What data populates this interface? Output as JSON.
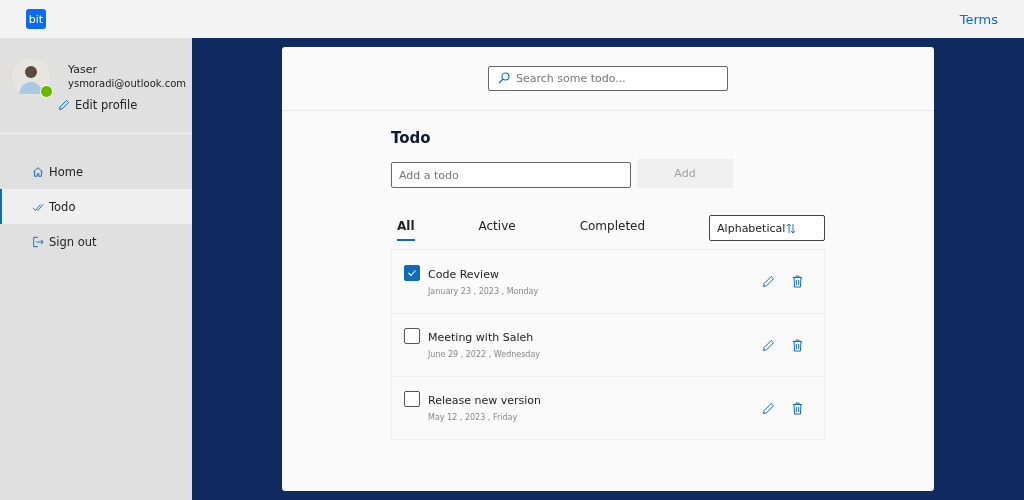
{
  "header": {
    "logo": "bit",
    "link": "Terms"
  },
  "profile": {
    "name": "Yaser",
    "email": "ysmoradi@outlook.com",
    "online": true,
    "edit_label": "Edit profile"
  },
  "nav": [
    {
      "label": "Home",
      "kind": "home",
      "selected": false
    },
    {
      "label": "Todo",
      "kind": "todo",
      "selected": true
    },
    {
      "label": "Sign out",
      "kind": "signout",
      "selected": false
    }
  ],
  "search": {
    "placeholder": "Search some todo..."
  },
  "title": "Todo",
  "add": {
    "placeholder": "Add a todo",
    "button": "Add",
    "disabled": true
  },
  "tabs": [
    {
      "label": "All",
      "selected": true
    },
    {
      "label": "Active",
      "selected": false
    },
    {
      "label": "Completed",
      "selected": false
    }
  ],
  "sort": {
    "value": "Alphabetical"
  },
  "todos": [
    {
      "title": "Code Review",
      "date": "January 23 , 2023 , Monday",
      "checked": true
    },
    {
      "title": "Meeting with Saleh",
      "date": "June 29 , 2022 , Wednesday",
      "checked": false
    },
    {
      "title": "Release new version",
      "date": "May 12 , 2023 , Friday",
      "checked": false
    }
  ]
}
